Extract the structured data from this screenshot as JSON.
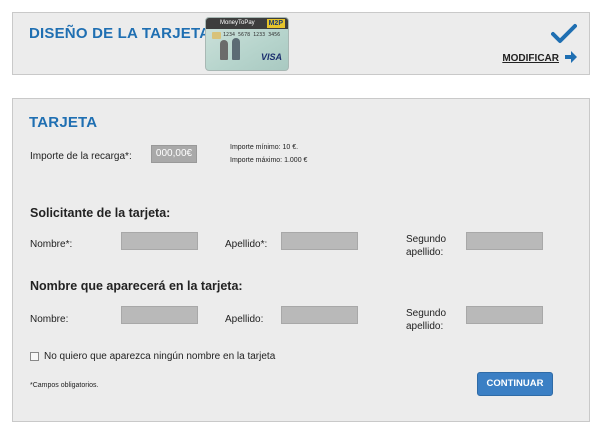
{
  "design": {
    "title": "DISEÑO DE LA TARJETA",
    "modify_label": "MODIFICAR",
    "card_preview": {
      "brand": "MoneyToPay",
      "badge": "M2P",
      "number": "1234 5678 1233 3456",
      "network": "VISA"
    }
  },
  "card_section": {
    "title": "TARJETA",
    "amount_label": "Importe de la recarga*:",
    "amount_value": "000,00€",
    "min_note": "Importe mínimo: 10 €.",
    "max_note": "Importe máximo: 1.000 €"
  },
  "applicant": {
    "heading": "Solicitante de la tarjeta:",
    "name_label": "Nombre*:",
    "surname_label": "Apellido*:",
    "second_surname_label_1": "Segundo",
    "second_surname_label_2": "apellido:",
    "name_value": "",
    "surname_value": "",
    "second_surname_value": ""
  },
  "card_name": {
    "heading": "Nombre que aparecerá en la tarjeta:",
    "name_label": "Nombre:",
    "surname_label": "Apellido:",
    "second_surname_label_1": "Segundo",
    "second_surname_label_2": "apellido:",
    "name_value": "",
    "surname_value": "",
    "second_surname_value": ""
  },
  "no_name_checkbox_label": "No quiero que aparezca ningún nombre en la tarjeta",
  "required_note": "*Campos obligatorios.",
  "continue_label": "CONTINUAR",
  "colors": {
    "accent": "#1f6fb2",
    "button": "#3b7fc4",
    "panel": "#ececec",
    "field": "#b9b9b9"
  }
}
